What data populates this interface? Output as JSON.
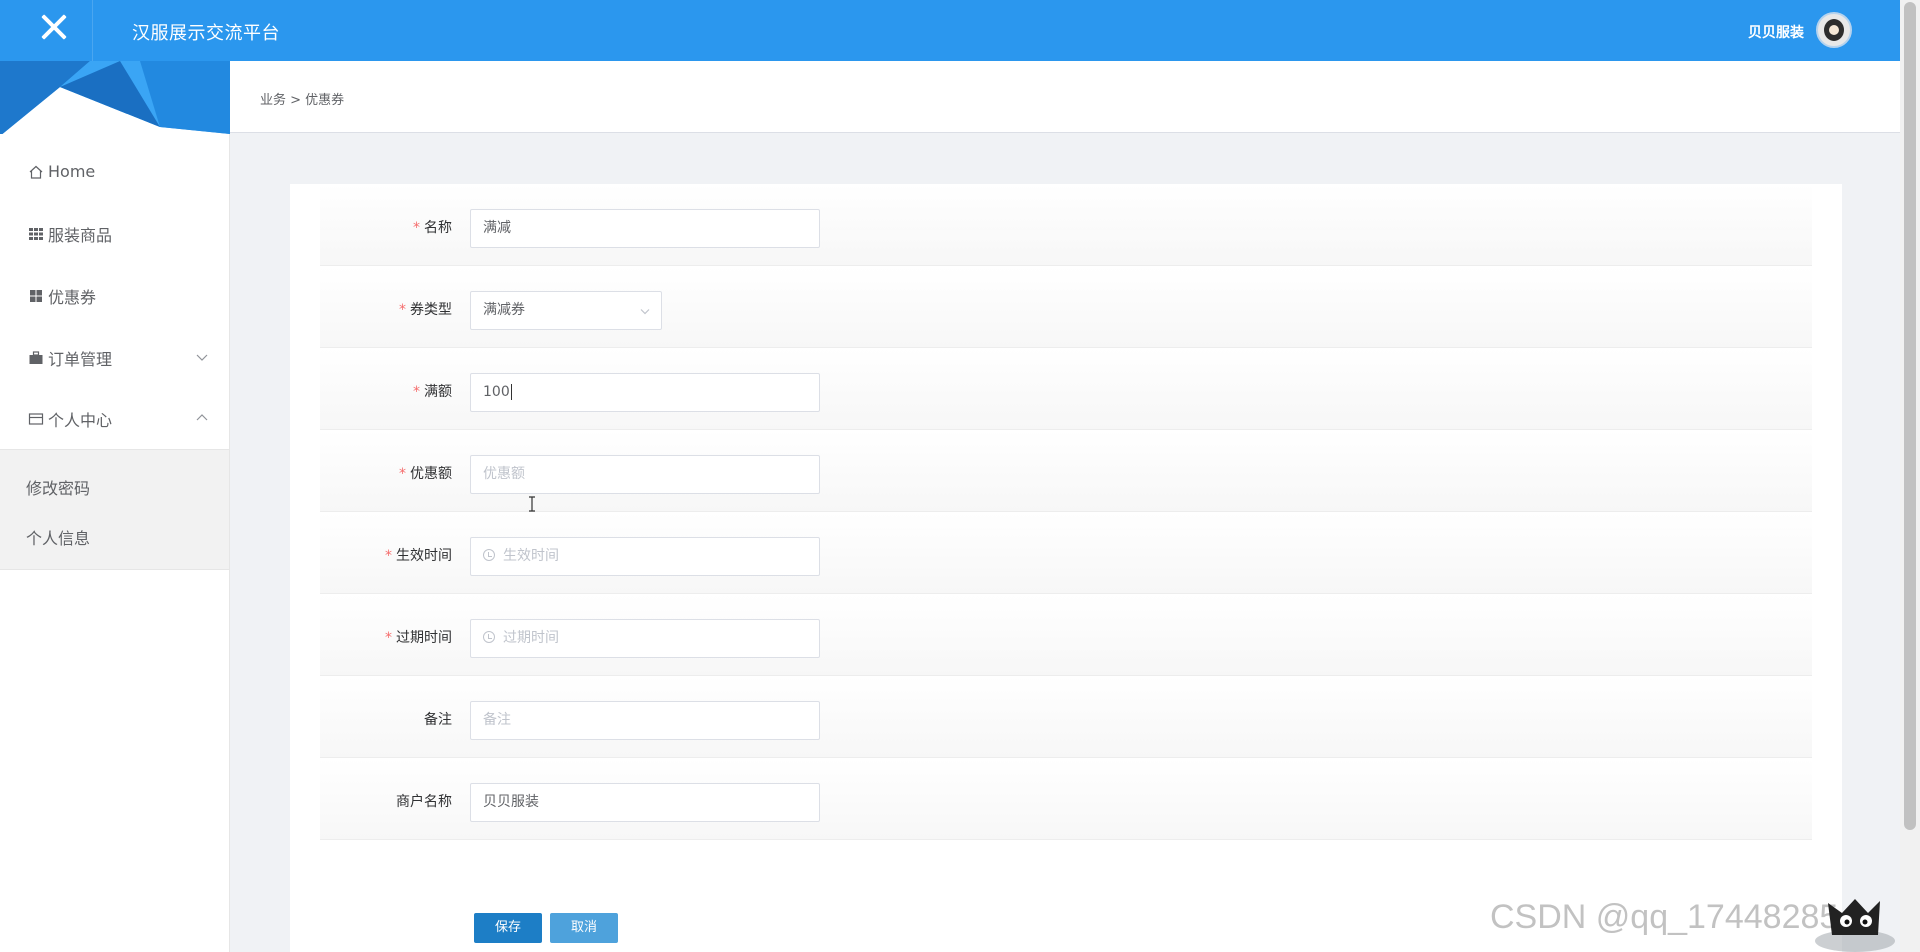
{
  "app": {
    "title": "汉服展示交流平台",
    "user_name": "贝贝服装"
  },
  "sidebar": {
    "items": [
      {
        "label": "Home",
        "icon": "home-icon"
      },
      {
        "label": "服装商品",
        "icon": "grid-icon"
      },
      {
        "label": "优惠券",
        "icon": "apps-icon"
      },
      {
        "label": "订单管理",
        "icon": "briefcase-icon",
        "expanded": false
      },
      {
        "label": "个人中心",
        "icon": "wallet-icon",
        "expanded": true
      }
    ],
    "submenu": [
      {
        "label": "修改密码"
      },
      {
        "label": "个人信息"
      }
    ]
  },
  "breadcrumb": "业务 > 优惠券",
  "form": {
    "fields": [
      {
        "label": "名称",
        "required": true,
        "value": "满减",
        "placeholder": ""
      },
      {
        "label": "券类型",
        "required": true,
        "value": "满减券",
        "type": "select"
      },
      {
        "label": "满额",
        "required": true,
        "value": "100",
        "placeholder": ""
      },
      {
        "label": "优惠额",
        "required": true,
        "value": "",
        "placeholder": "优惠额"
      },
      {
        "label": "生效时间",
        "required": true,
        "value": "",
        "placeholder": "生效时间"
      },
      {
        "label": "过期时间",
        "required": true,
        "value": "",
        "placeholder": "过期时间"
      },
      {
        "label": "备注",
        "required": false,
        "value": "",
        "placeholder": "备注"
      },
      {
        "label": "商户名称",
        "required": false,
        "value": "贝贝服装",
        "placeholder": ""
      }
    ],
    "buttons": {
      "save": "保存",
      "cancel": "取消"
    },
    "required_mark": "*"
  },
  "watermark": "CSDN @qq_17448285",
  "colors": {
    "topbar": "#2b97ee",
    "primary_button": "#1d7ec6",
    "secondary_button": "#4ea2dc",
    "required": "#f56c6c"
  }
}
